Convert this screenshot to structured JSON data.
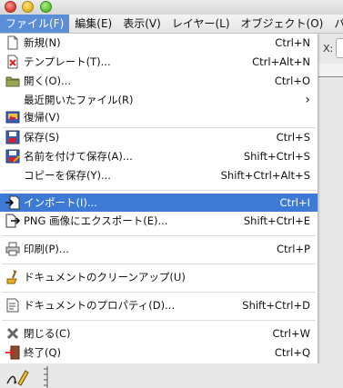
{
  "menubar": {
    "items": [
      {
        "label": "ファイル(F)"
      },
      {
        "label": "編集(E)"
      },
      {
        "label": "表示(V)"
      },
      {
        "label": "レイヤー(L)"
      },
      {
        "label": "オブジェクト(O)"
      },
      {
        "label": "パ"
      }
    ]
  },
  "toolbar": {
    "x_label": "X:"
  },
  "file_menu": {
    "items": [
      {
        "label": "新規(N)",
        "shortcut": "Ctrl+N",
        "icon": "new-document-icon"
      },
      {
        "label": "テンプレート(T)...",
        "shortcut": "Ctrl+Alt+N",
        "icon": "template-icon"
      },
      {
        "label": "開く(O)...",
        "shortcut": "Ctrl+O",
        "icon": "open-folder-icon"
      },
      {
        "label": "最近開いたファイル(R)",
        "shortcut": "›",
        "icon": ""
      },
      {
        "label": "復帰(V)",
        "shortcut": "",
        "icon": "revert-icon"
      },
      {
        "label": "保存(S)",
        "shortcut": "Ctrl+S",
        "icon": "save-icon"
      },
      {
        "label": "名前を付けて保存(A)...",
        "shortcut": "Shift+Ctrl+S",
        "icon": "save-as-icon"
      },
      {
        "label": "コピーを保存(Y)...",
        "shortcut": "Shift+Ctrl+Alt+S",
        "icon": ""
      },
      {
        "label": "インポート(I)...",
        "shortcut": "Ctrl+I",
        "icon": "import-icon"
      },
      {
        "label": "PNG 画像にエクスポート(E)...",
        "shortcut": "Shift+Ctrl+E",
        "icon": "export-icon"
      },
      {
        "label": "印刷(P)...",
        "shortcut": "Ctrl+P",
        "icon": "print-icon"
      },
      {
        "label": "ドキュメントのクリーンアップ(U)",
        "shortcut": "",
        "icon": "cleanup-icon"
      },
      {
        "label": "ドキュメントのプロパティ(D)...",
        "shortcut": "Shift+Ctrl+D",
        "icon": "properties-icon"
      },
      {
        "label": "閉じる(C)",
        "shortcut": "Ctrl+W",
        "icon": "close-icon"
      },
      {
        "label": "終了(Q)",
        "shortcut": "Ctrl+Q",
        "icon": "quit-icon"
      }
    ]
  },
  "colors": {
    "highlight": "#3d7ad6",
    "menubar_active": "#5a8ed6"
  }
}
